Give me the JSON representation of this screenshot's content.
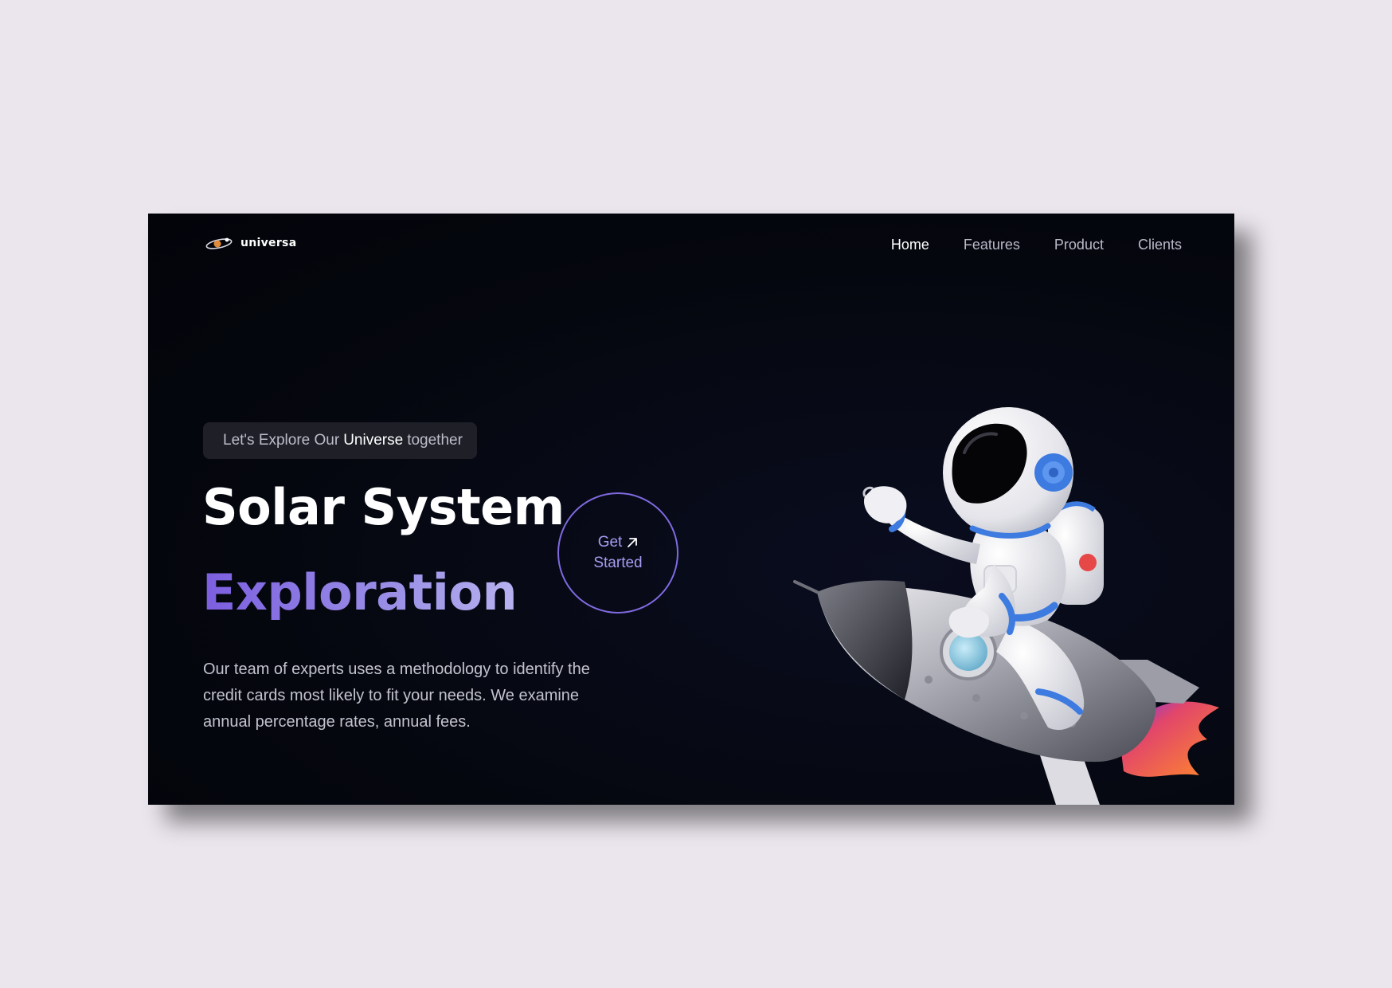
{
  "brand": {
    "name": "universa",
    "logo_icon": "planet-ring-icon"
  },
  "nav": {
    "items": [
      {
        "label": "Home",
        "active": true
      },
      {
        "label": "Features",
        "active": false
      },
      {
        "label": "Product",
        "active": false
      },
      {
        "label": "Clients",
        "active": false
      }
    ]
  },
  "hero": {
    "tagline_prefix": "Let's Explore Our",
    "tagline_highlight": "Universe",
    "tagline_suffix": "together",
    "title_line1": "Solar System",
    "title_line2": "Exploration",
    "cta_line1": "Get",
    "cta_line2": "Started",
    "cta_icon": "arrow-up-right-icon",
    "description": "Our team of experts uses a methodology to identify the credit cards most likely to fit your needs. We examine annual percentage rates, annual fees.",
    "illustration": "astronaut-riding-rocket"
  },
  "colors": {
    "page_background": "#ebe6ee",
    "frame_background": "#05070f",
    "accent": "#8f7be0",
    "text_primary": "#ffffff",
    "text_muted": "#c3c3cf"
  }
}
